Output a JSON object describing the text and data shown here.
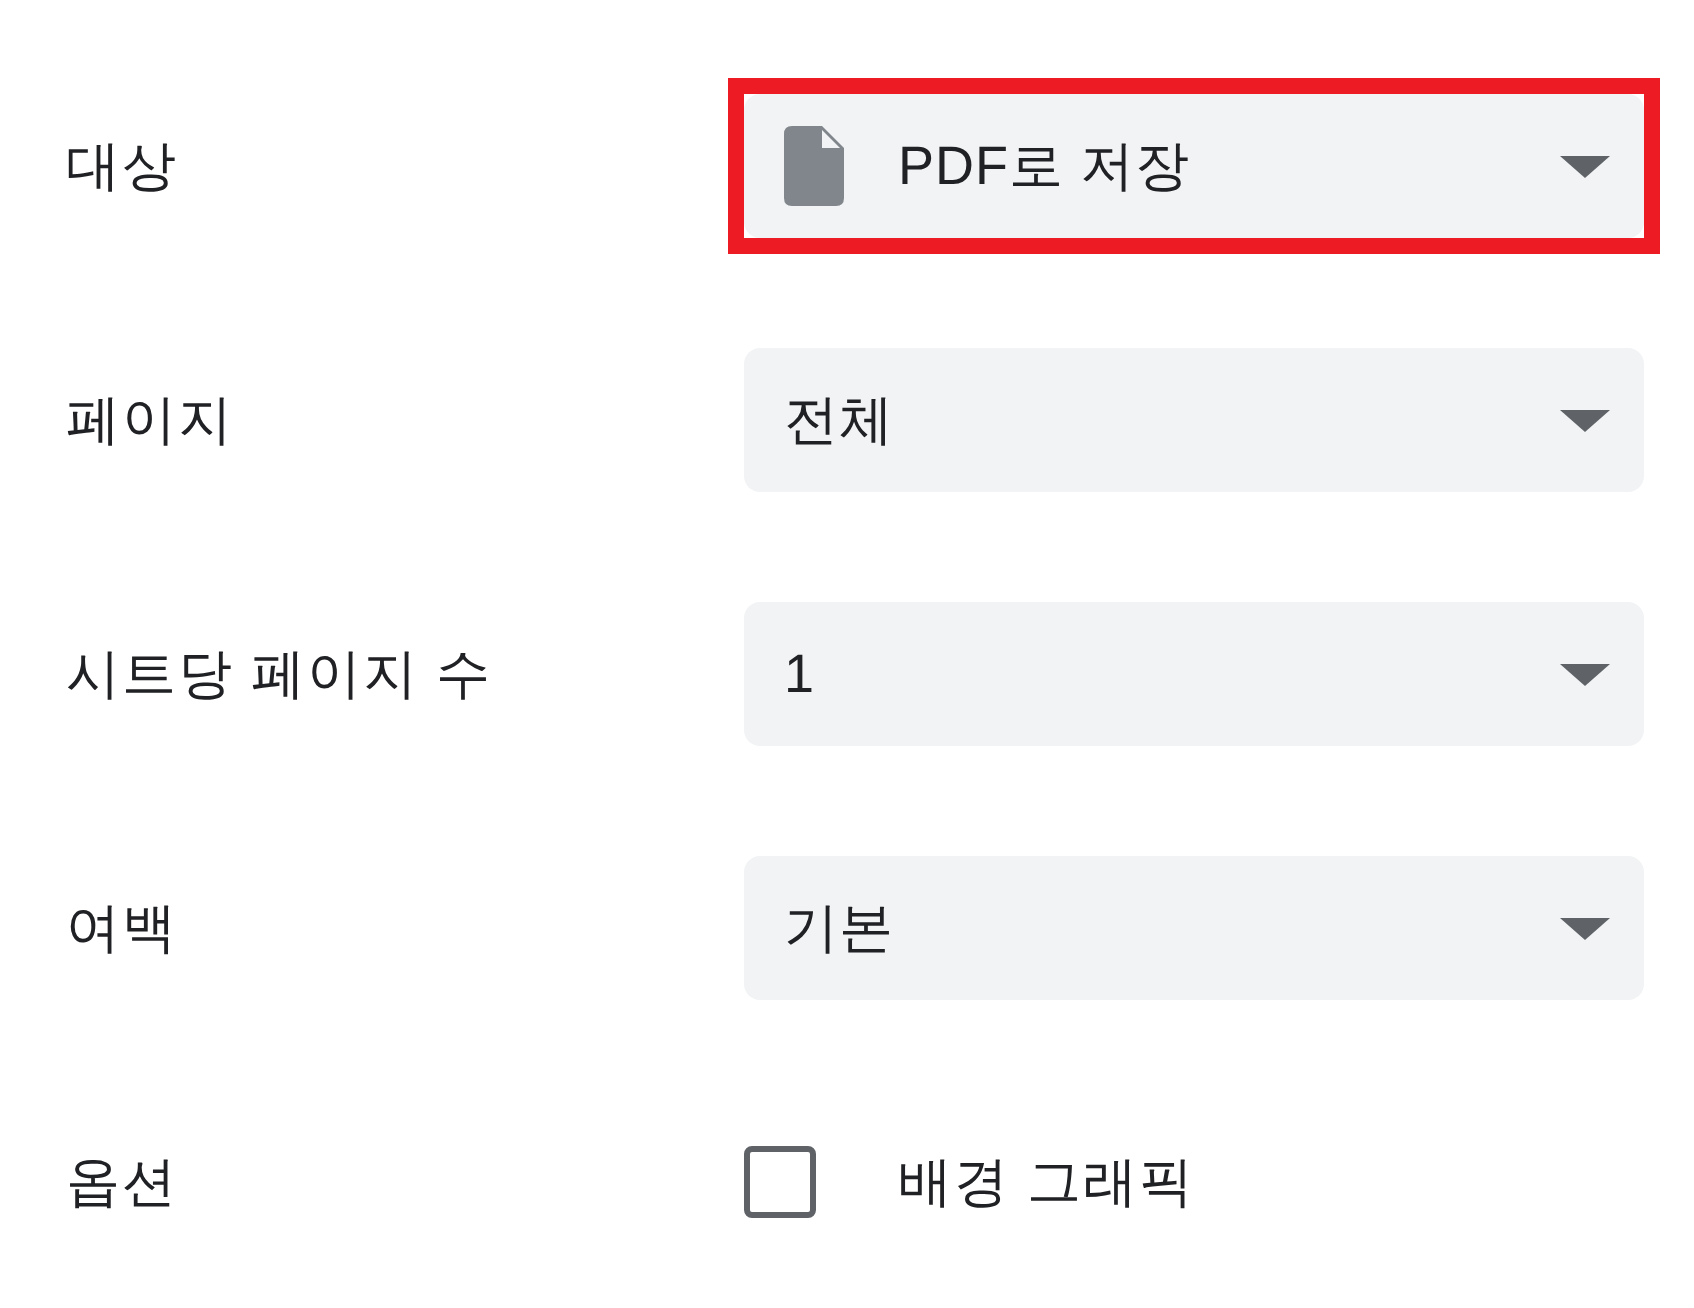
{
  "settings": [
    {
      "kind": "select",
      "label": "대상",
      "value": "PDF로 저장",
      "icon": true,
      "highlighted": true
    },
    {
      "kind": "select",
      "label": "페이지",
      "value": "전체",
      "highlighted": false
    },
    {
      "kind": "select",
      "label": "시트당 페이지 수",
      "value": "1",
      "highlighted": false
    },
    {
      "kind": "select",
      "label": "여백",
      "value": "기본",
      "highlighted": false
    },
    {
      "kind": "checkbox",
      "label": "옵션",
      "text": "배경 그래픽",
      "checked": false,
      "highlighted": false
    }
  ]
}
